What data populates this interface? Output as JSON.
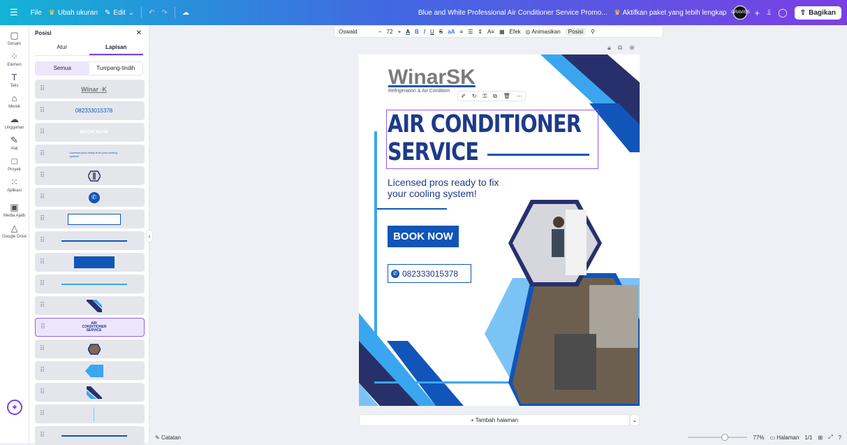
{
  "topbar": {
    "menu_icon": "hamburger-icon",
    "file": "File",
    "resize": "Ubah ukuran",
    "edit": "Edit",
    "doc_title": "Blue and White Professional Air Conditioner Service Promo...",
    "upgrade": "Aktifkan paket yang lebih lengkap",
    "avatar_text": "GRAVIES",
    "share": "Bagikan"
  },
  "rail": {
    "items": [
      {
        "label": "Desain",
        "icon": "▢"
      },
      {
        "label": "Elemen",
        "icon": "⁘"
      },
      {
        "label": "Teks",
        "icon": "T"
      },
      {
        "label": "Merek",
        "icon": "⌂"
      },
      {
        "label": "Unggahan",
        "icon": "☁"
      },
      {
        "label": "Alat",
        "icon": "✎"
      },
      {
        "label": "Proyek",
        "icon": "□"
      },
      {
        "label": "Aplikasi",
        "icon": "⁙"
      },
      {
        "label": "Media Ajaib",
        "icon": "▣"
      },
      {
        "label": "Google Drive",
        "icon": "△"
      }
    ]
  },
  "panel": {
    "title": "Posisi",
    "close": "✕",
    "tabs": [
      "Atur",
      "Lapisan"
    ],
    "seg": [
      "Semua",
      "Tumpang-tindih"
    ],
    "layers": [
      {
        "text": "Winar◌K"
      },
      {
        "text": "082333015378"
      },
      {
        "text": "BOOK NOW"
      },
      {
        "text": "Licensed pros ready to fix your cooling system!"
      },
      {
        "text": ""
      },
      {
        "text": ""
      },
      {
        "text": ""
      },
      {
        "text": ""
      },
      {
        "text": ""
      },
      {
        "text": ""
      },
      {
        "text": ""
      },
      {
        "text": "AIR CONDITIONER SERVICE"
      },
      {
        "text": ""
      },
      {
        "text": ""
      },
      {
        "text": ""
      },
      {
        "text": ""
      },
      {
        "text": ""
      }
    ]
  },
  "format": {
    "font": "Oswald",
    "minus": "−",
    "size": "72",
    "plus": "+",
    "effects": "Efek",
    "animate": "Animasikan",
    "position": "Posisi"
  },
  "design": {
    "logo": "WinarSK",
    "tagline": "Refrigeration & Air Condition",
    "headline_1": "AIR CONDITIONER",
    "headline_2": "SERVICE",
    "sub_1": "Licensed pros ready to fix",
    "sub_2": "your cooling system!",
    "cta": "BOOK NOW",
    "phone": "082333015378",
    "colors": {
      "navy": "#28306b",
      "blue": "#1155b8",
      "sky": "#3aa6f0",
      "light": "#7cc3f5"
    }
  },
  "add_page": "+ Tambah halaman",
  "footer": {
    "notes": "Catatan",
    "zoom": "77%",
    "pages_label": "Halaman",
    "pages": "1/1"
  }
}
